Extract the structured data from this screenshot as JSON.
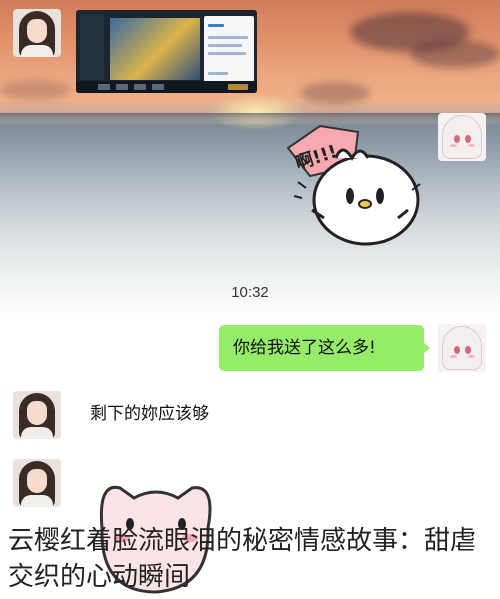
{
  "chat": {
    "time_stamp": "10:32",
    "messages": [
      {
        "from": "me",
        "text": "你给我送了这么多!"
      },
      {
        "from": "them",
        "text": "剩下的妳应该够"
      }
    ]
  },
  "stickers": {
    "top_text": "啊!!!"
  },
  "caption": {
    "title": "云樱红着脸流眼泪的秘密情感故事：甜虐交织的心动瞬间"
  },
  "colors": {
    "my_bubble": "#95ec69",
    "their_bubble": "#ffffff"
  },
  "icons": {
    "sticker_top": "chick-shouting-sticker",
    "sticker_bottom": "pink-cat-sticker",
    "video": "video-thumbnail"
  }
}
